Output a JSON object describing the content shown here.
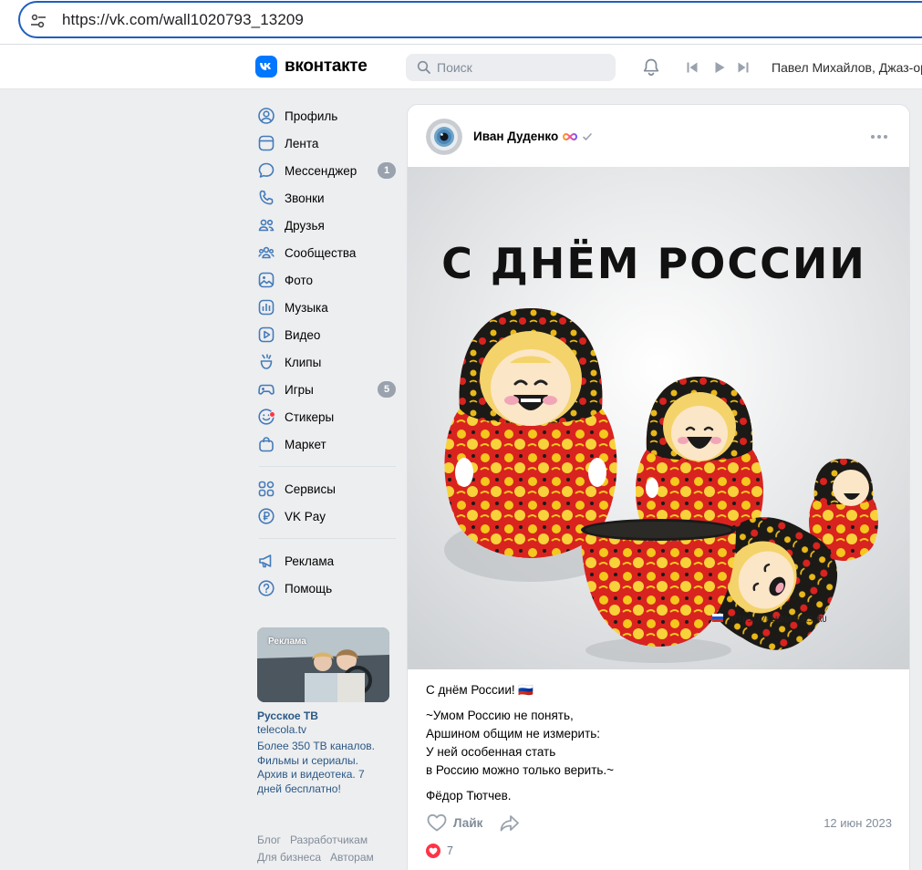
{
  "browser": {
    "url": "https://vk.com/wall1020793_13209"
  },
  "header": {
    "logo_text": "вконтакте",
    "search_placeholder": "Поиск",
    "now_playing": "Павел Михайлов, Джаз-оркестр"
  },
  "nav": {
    "items": [
      {
        "label": "Профиль",
        "icon": "user-icon"
      },
      {
        "label": "Лента",
        "icon": "feed-icon"
      },
      {
        "label": "Мессенджер",
        "icon": "message-icon",
        "badge": "1"
      },
      {
        "label": "Звонки",
        "icon": "phone-icon"
      },
      {
        "label": "Друзья",
        "icon": "friends-icon"
      },
      {
        "label": "Сообщества",
        "icon": "communities-icon"
      },
      {
        "label": "Фото",
        "icon": "photo-icon"
      },
      {
        "label": "Музыка",
        "icon": "music-icon"
      },
      {
        "label": "Видео",
        "icon": "video-icon"
      },
      {
        "label": "Клипы",
        "icon": "clips-icon"
      },
      {
        "label": "Игры",
        "icon": "games-icon",
        "badge": "5"
      },
      {
        "label": "Стикеры",
        "icon": "stickers-icon"
      },
      {
        "label": "Маркет",
        "icon": "market-icon"
      }
    ],
    "services": [
      {
        "label": "Сервисы",
        "icon": "services-icon"
      },
      {
        "label": "VK Pay",
        "icon": "vkpay-icon"
      }
    ],
    "support": [
      {
        "label": "Реклама",
        "icon": "ads-icon"
      },
      {
        "label": "Помощь",
        "icon": "help-icon"
      }
    ]
  },
  "ad": {
    "tag": "Реклама",
    "title": "Русское ТВ",
    "domain": "telecola.tv",
    "text": "Более 350 ТВ каналов. Фильмы и сериалы. Архив и видеотека. 7 дней бесплатно!"
  },
  "footer": {
    "links": [
      "Блог",
      "Разработчикам",
      "Для бизнеса",
      "Авторам"
    ]
  },
  "post": {
    "author": "Иван Дуденко",
    "image_title": "С ДНЁМ РОССИИ",
    "watermark": "HTTPS://KLUBDEMOKS.RU",
    "greeting": "С днём России! 🇷🇺",
    "poem_line_1": "~Умом Россию не понять,",
    "poem_line_2": "Аршином общим не измерить:",
    "poem_line_3": "У ней особенная стать",
    "poem_line_4": "в Россию можно только верить.~",
    "signature": "Фёдор Тютчев.",
    "like_label": "Лайк",
    "date": "12 июн 2023",
    "reaction_count": "7"
  },
  "colors": {
    "accent": "#0077ff",
    "link": "#2a5885",
    "badge": "#99a2ad",
    "heart": "#ff3347"
  }
}
